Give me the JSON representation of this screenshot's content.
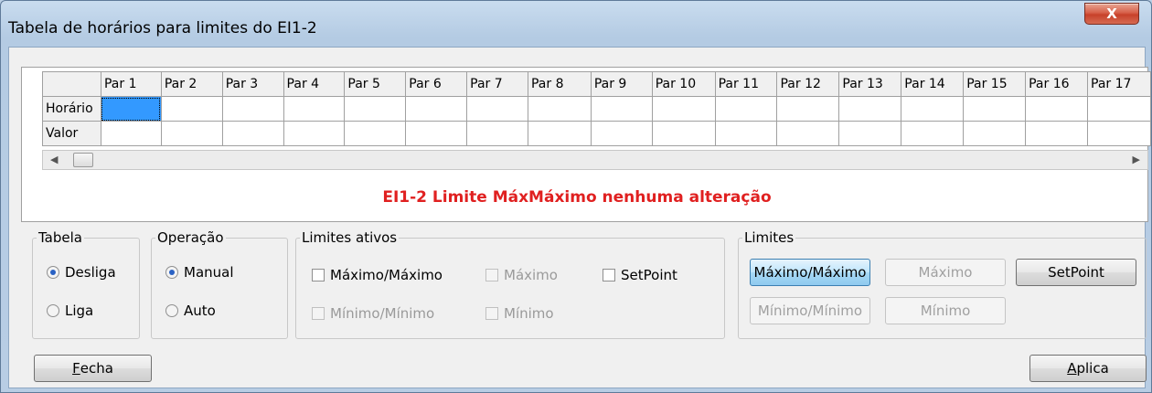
{
  "window": {
    "title": "Tabela de horários para limites do EI1-2",
    "close_label": "X"
  },
  "grid": {
    "columns": [
      "Par 1",
      "Par 2",
      "Par 3",
      "Par 4",
      "Par 5",
      "Par 6",
      "Par 7",
      "Par 8",
      "Par 9",
      "Par 10",
      "Par 11",
      "Par 12",
      "Par 13",
      "Par 14",
      "Par 15",
      "Par 16",
      "Par 17"
    ],
    "rows": [
      "Horário",
      "Valor"
    ]
  },
  "status_message": "EI1-2  Limite MáxMáximo nenhuma alteração",
  "tabela": {
    "legend": "Tabela",
    "options": [
      {
        "label": "Desliga",
        "selected": true
      },
      {
        "label": "Liga",
        "selected": false
      }
    ]
  },
  "operacao": {
    "legend": "Operação",
    "options": [
      {
        "label": "Manual",
        "selected": true
      },
      {
        "label": "Auto",
        "selected": false
      }
    ]
  },
  "limites_ativos": {
    "legend": "Limites ativos",
    "maxmax": "Máximo/Máximo",
    "max": "Máximo",
    "setpoint": "SetPoint",
    "minmin": "Mínimo/Mínimo",
    "min": "Mínimo"
  },
  "limites": {
    "legend": "Limites",
    "maxmax": "Máximo/Máximo",
    "max": "Máximo",
    "setpoint": "SetPoint",
    "minmin": "Mínimo/Mínimo",
    "min": "Mínimo"
  },
  "buttons": {
    "fecha_first": "F",
    "fecha_rest": "echa",
    "aplica_first": "A",
    "aplica_rest": "plica"
  },
  "colors": {
    "status_red": "#e02020",
    "selection_blue": "#3399ff"
  }
}
